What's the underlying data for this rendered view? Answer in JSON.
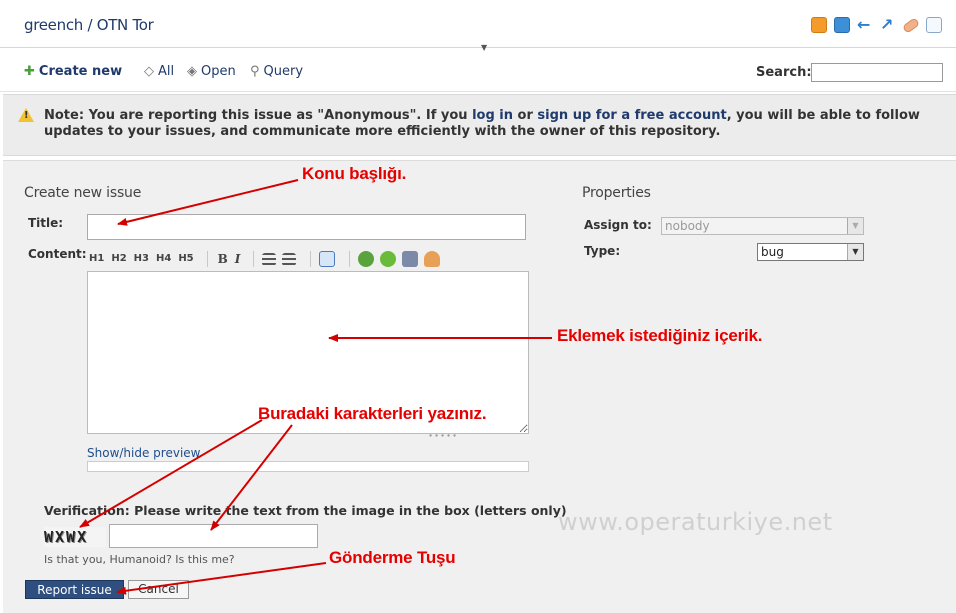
{
  "header": {
    "repo_owner": "greench",
    "separator": "/",
    "repo_name": "OTN Tor",
    "icons": [
      "rss-icon",
      "atom-feed-icon",
      "back-arrow-icon",
      "up-arrow-icon",
      "patch-icon",
      "document-icon"
    ]
  },
  "toolbar": {
    "create_label": "Create new",
    "all_label": "All",
    "open_label": "Open",
    "query_label": "Query",
    "search_label": "Search:",
    "search_value": ""
  },
  "notice": {
    "prefix": "Note: You are reporting this issue as \"Anonymous\". If you ",
    "login_link": "log in",
    "middle": " or ",
    "signup_link": "sign up for a free account",
    "suffix": ", you will be able to follow updates to your issues, and communicate more efficiently with the owner of this repository."
  },
  "form": {
    "heading": "Create new issue",
    "title_label": "Title:",
    "title_value": "",
    "content_label": "Content:",
    "editor_buttons": [
      "H1",
      "H2",
      "H3",
      "H4",
      "H5",
      "B",
      "I"
    ],
    "content_value": "",
    "preview_link": "Show/hide preview",
    "verification_text": "Verification: Please write the text from the image in the box (letters only)",
    "captcha_text": "WXWX",
    "captcha_value": "",
    "captcha_hint": "Is that you, Humanoid? Is this me?",
    "submit_label": "Report issue",
    "cancel_label": "Cancel"
  },
  "properties": {
    "heading": "Properties",
    "assign_label": "Assign to:",
    "assign_value": "nobody",
    "type_label": "Type:",
    "type_value": "bug"
  },
  "annotations": {
    "title_note": "Konu başlığı.",
    "content_note": "Eklemek istediğiniz içerik.",
    "captcha_note": "Buradaki karakterleri yazınız.",
    "submit_note": "Gönderme Tuşu",
    "watermark": "www.operaturkiye.net",
    "arrow_color": "#d40000"
  }
}
